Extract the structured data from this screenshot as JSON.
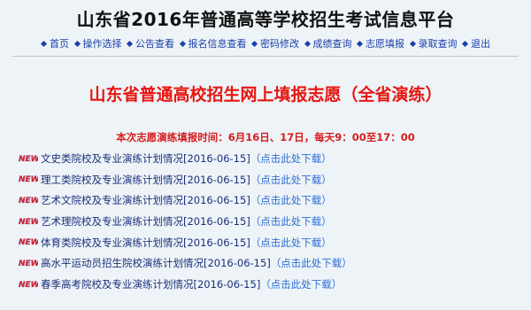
{
  "header": {
    "title": "山东省2016年普通高等学校招生考试信息平台"
  },
  "nav": {
    "items": [
      {
        "label": "首页"
      },
      {
        "label": "操作选择"
      },
      {
        "label": "公告查看"
      },
      {
        "label": "报名信息查看"
      },
      {
        "label": "密码修改"
      },
      {
        "label": "成绩查询"
      },
      {
        "label": "志愿填报"
      },
      {
        "label": "录取查询"
      },
      {
        "label": "退出"
      }
    ]
  },
  "main": {
    "heading": "山东省普通高校招生网上填报志愿（全省演练）",
    "schedule": "本次志愿演练填报时间：6月16日、17日，每天9：00至17：00",
    "badge_text": "NEW",
    "items": [
      {
        "title": "文史类院校及专业演练计划情况[2016-06-15]",
        "link": "（点击此处下载）"
      },
      {
        "title": "理工类院校及专业演练计划情况[2016-06-15]",
        "link": "（点击此处下载）"
      },
      {
        "title": "艺术文院校及专业演练计划情况[2016-06-15]",
        "link": "（点击此处下载）"
      },
      {
        "title": "艺术理院校及专业演练计划情况[2016-06-15]",
        "link": "（点击此处下载）"
      },
      {
        "title": "体育类院校及专业演练计划情况[2016-06-15]",
        "link": "（点击此处下载）"
      },
      {
        "title": "高水平运动员招生院校演练计划情况[2016-06-15]",
        "link": "（点击此处下载）"
      },
      {
        "title": "春季高考院校及专业演练计划情况[2016-06-15]",
        "link": "（点击此处下载）"
      }
    ]
  },
  "colors": {
    "background": "#eef3f7",
    "heading_red": "#e8150f",
    "nav_blue": "#1a3fa8",
    "link_blue": "#2c6fd6",
    "badge_red": "#e0251b",
    "badge_purple": "#7a2a9a"
  }
}
